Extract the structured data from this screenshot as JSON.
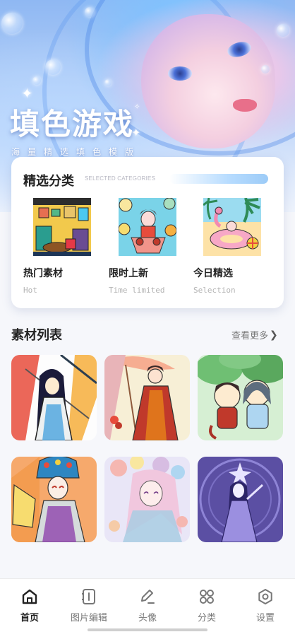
{
  "hero": {
    "title": "填色游戏",
    "subtitle": "海量精选填色模版"
  },
  "featured": {
    "title": "精选分类",
    "subtitle": "SELECTED CATEGORIES",
    "categories": [
      {
        "label": "热门素材",
        "en": "Hot"
      },
      {
        "label": "限时上新",
        "en": "Time limited"
      },
      {
        "label": "今日精选",
        "en": "Selection"
      }
    ]
  },
  "materials": {
    "title": "素材列表",
    "more": "查看更多",
    "tiles": [
      "tile-1",
      "tile-2",
      "tile-3",
      "tile-4",
      "tile-5",
      "tile-6"
    ]
  },
  "nav": {
    "items": [
      {
        "label": "首页",
        "icon": "home-icon",
        "active": true
      },
      {
        "label": "图片编辑",
        "icon": "image-edit-icon",
        "active": false
      },
      {
        "label": "头像",
        "icon": "pencil-icon",
        "active": false
      },
      {
        "label": "分类",
        "icon": "grid-icon",
        "active": false
      },
      {
        "label": "设置",
        "icon": "settings-icon",
        "active": false
      }
    ]
  },
  "colors": {
    "accent": "#9ccbf7",
    "text": "#222222",
    "muted": "#b4b4b4",
    "background": "#f6f7fb"
  }
}
